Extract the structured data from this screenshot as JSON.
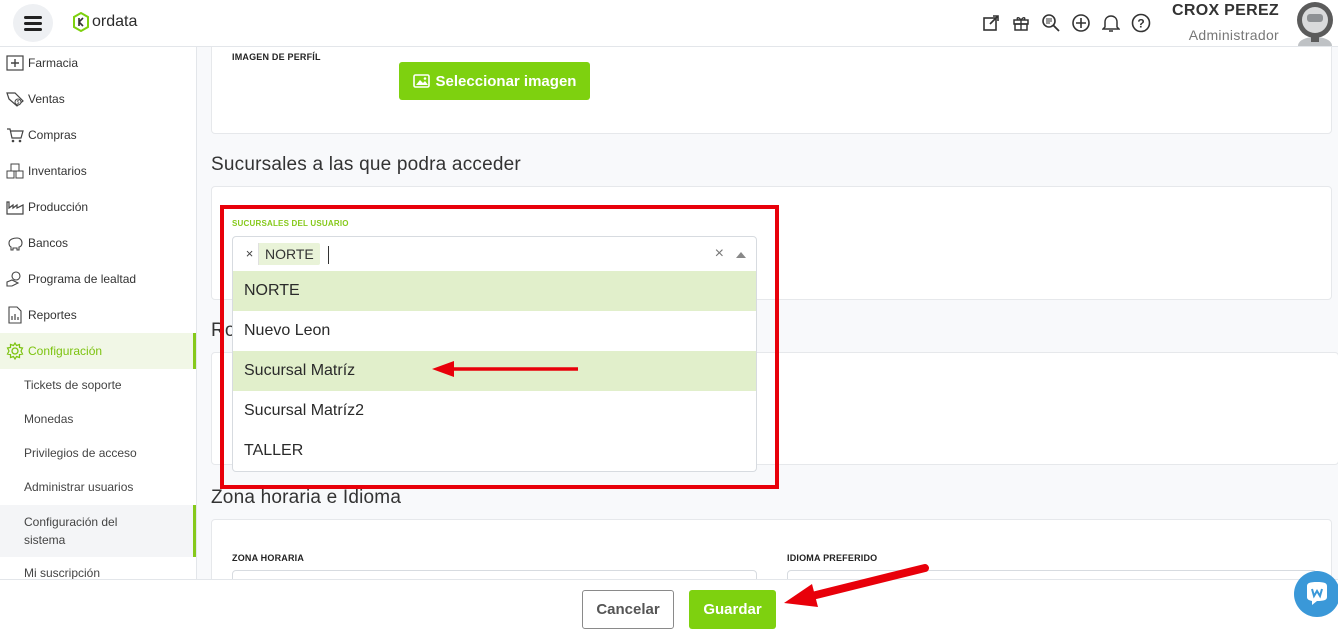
{
  "header": {
    "logo_text": "ordata",
    "user_name": "CROX PEREZ",
    "user_role": "Administrador",
    "icons": [
      "external-link-icon",
      "gift-icon",
      "search-zoom-icon",
      "add-circle-icon",
      "bell-icon",
      "help-icon"
    ]
  },
  "sidebar": {
    "items": [
      {
        "label": "Farmacia",
        "icon": "pharmacy-icon"
      },
      {
        "label": "Ventas",
        "icon": "sales-tag-icon"
      },
      {
        "label": "Compras",
        "icon": "cart-icon"
      },
      {
        "label": "Inventarios",
        "icon": "boxes-icon"
      },
      {
        "label": "Producción",
        "icon": "factory-icon"
      },
      {
        "label": "Bancos",
        "icon": "piggy-bank-icon"
      },
      {
        "label": "Programa de lealtad",
        "icon": "loyalty-icon"
      },
      {
        "label": "Reportes",
        "icon": "report-icon"
      },
      {
        "label": "Configuración",
        "icon": "gear-icon",
        "active": true
      }
    ],
    "sub_items": [
      {
        "label": "Tickets de soporte"
      },
      {
        "label": "Monedas"
      },
      {
        "label": "Privilegios de acceso"
      },
      {
        "label": "Administrar usuarios"
      },
      {
        "label": "Configuración del sistema",
        "active": true
      },
      {
        "label": "Mi suscripción"
      }
    ]
  },
  "profile": {
    "label": "IMAGEN DE PERFÍL",
    "select_button": "Seleccionar imagen"
  },
  "branches": {
    "section_title": "Sucursales a las que podra acceder",
    "field_label": "SUCURSALES DEL USUARIO",
    "selected_chip": "NORTE",
    "chip_remove": "×",
    "clear": "×",
    "options": [
      {
        "label": "NORTE",
        "selected": true
      },
      {
        "label": "Nuevo Leon",
        "selected": false
      },
      {
        "label": "Sucursal Matríz",
        "selected": true
      },
      {
        "label": "Sucursal Matríz2",
        "selected": false
      },
      {
        "label": "TALLER",
        "selected": false
      }
    ]
  },
  "partial_section_title": "Ro",
  "timezone": {
    "section_title": "Zona horaria e Idioma",
    "tz_label": "ZONA HORARIA",
    "lang_label": "IDIOMA PREFERIDO"
  },
  "footer": {
    "cancel": "Cancelar",
    "save": "Guardar"
  },
  "colors": {
    "accent": "#7ed10f",
    "highlight": "#e1efcb",
    "annotation": "#e8000a"
  }
}
